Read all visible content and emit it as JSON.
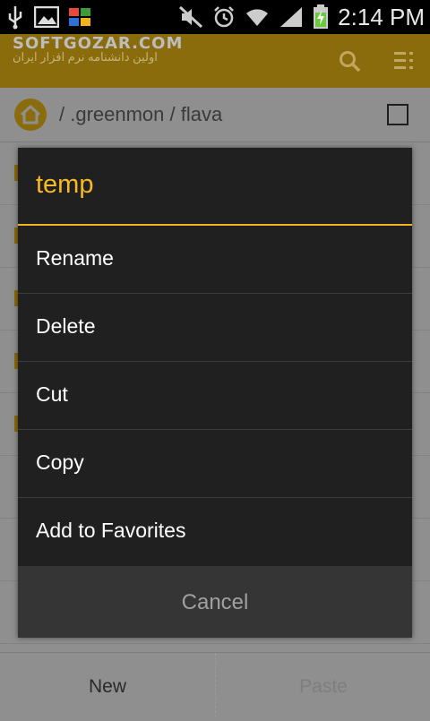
{
  "status_bar": {
    "time": "2:14 PM",
    "icons": [
      "usb-icon",
      "image-icon",
      "store-icon",
      "mute-icon",
      "alarm-icon",
      "wifi-icon",
      "signal-icon",
      "battery-charging-icon"
    ]
  },
  "header": {
    "brand": "SOFTGOZAR.COM",
    "brand_subtitle": "اولین دانشنامه نرم افزار ایران",
    "icons": [
      "search-icon",
      "menu-icon"
    ],
    "accent_color": "#8a6c0c"
  },
  "path_bar": {
    "path": "/ .greenmon / flava"
  },
  "dialog": {
    "title": "temp",
    "accent_color": "#f2b21e",
    "items": [
      {
        "label": "Rename"
      },
      {
        "label": "Delete"
      },
      {
        "label": "Cut"
      },
      {
        "label": "Copy"
      },
      {
        "label": "Add to Favorites"
      }
    ],
    "cancel_label": "Cancel"
  },
  "bottom_bar": {
    "new_label": "New",
    "paste_label": "Paste"
  }
}
